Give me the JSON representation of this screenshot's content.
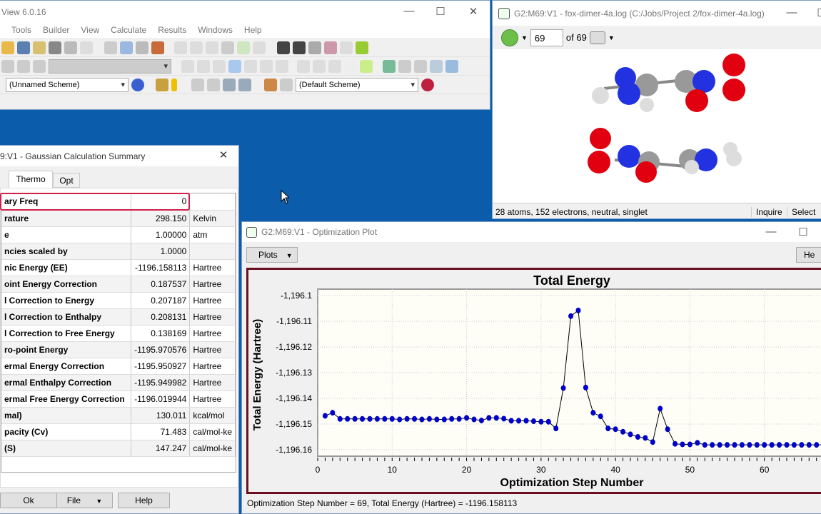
{
  "main_window": {
    "title": "View 6.0.16",
    "menu": [
      "Tools",
      "Builder",
      "View",
      "Calculate",
      "Results",
      "Windows",
      "Help"
    ],
    "scheme_left": "(Unnamed Scheme)",
    "scheme_right": "(Default Scheme)"
  },
  "molecule_window": {
    "title": "G2:M69:V1 - fox-dimer-4a.log (C:/Jobs/Project 2/fox-dimer-4a.log)",
    "frame": "69",
    "of_label": "of 69",
    "status": "28 atoms, 152 electrons, neutral, singlet",
    "inquire": "Inquire",
    "select": "Select"
  },
  "summary": {
    "title": "9:V1 - Gaussian Calculation Summary",
    "tabs": [
      "Thermo",
      "Opt"
    ],
    "active_tab": "Thermo",
    "rows": [
      {
        "label": "ary Freq",
        "value": "0",
        "unit": ""
      },
      {
        "label": "rature",
        "value": "298.150",
        "unit": "Kelvin"
      },
      {
        "label": "e",
        "value": "1.00000",
        "unit": "atm"
      },
      {
        "label": "ncies scaled by",
        "value": "1.0000",
        "unit": ""
      },
      {
        "label": "nic Energy (EE)",
        "value": "-1196.158113",
        "unit": "Hartree"
      },
      {
        "label": "oint Energy Correction",
        "value": "0.187537",
        "unit": "Hartree"
      },
      {
        "label": "l Correction to Energy",
        "value": "0.207187",
        "unit": "Hartree"
      },
      {
        "label": "l Correction to Enthalpy",
        "value": "0.208131",
        "unit": "Hartree"
      },
      {
        "label": "l Correction to Free Energy",
        "value": "0.138169",
        "unit": "Hartree"
      },
      {
        "label": "ro-point Energy",
        "value": "-1195.970576",
        "unit": "Hartree"
      },
      {
        "label": "ermal Energy Correction",
        "value": "-1195.950927",
        "unit": "Hartree"
      },
      {
        "label": "ermal Enthalpy Correction",
        "value": "-1195.949982",
        "unit": "Hartree"
      },
      {
        "label": "ermal Free Energy Correction",
        "value": "-1196.019944",
        "unit": "Hartree"
      },
      {
        "label": "mal)",
        "value": "130.011",
        "unit": "kcal/mol"
      },
      {
        "label": "pacity (Cv)",
        "value": "71.483",
        "unit": "cal/mol-ke"
      },
      {
        "label": "(S)",
        "value": "147.247",
        "unit": "cal/mol-ke"
      }
    ],
    "buttons": {
      "ok": "Ok",
      "file": "File",
      "help": "Help"
    }
  },
  "plot_window": {
    "title": "G2:M69:V1 - Optimization Plot",
    "plots_button": "Plots",
    "help_button": "He",
    "status": "Optimization Step Number = 69, Total Energy (Hartree) = -1196.158113"
  },
  "chart_data": {
    "type": "line",
    "title": "Total Energy",
    "xlabel": "Optimization Step Number",
    "ylabel": "Total Energy (Hartree)",
    "xlim": [
      0,
      70
    ],
    "ylim": [
      -1196.1625,
      -1196.0975
    ],
    "xticks": [
      0,
      10,
      20,
      30,
      40,
      50,
      60
    ],
    "xtick_labels": [
      "0",
      "10",
      "20",
      "30",
      "40",
      "50",
      "60"
    ],
    "yticks": [
      -1196.1,
      -1196.11,
      -1196.12,
      -1196.13,
      -1196.14,
      -1196.15,
      -1196.16
    ],
    "ytick_labels": [
      "-1,196.1",
      "-1,196.11",
      "-1,196.12",
      "-1,196.13",
      "-1,196.14",
      "-1,196.15",
      "-1,196.16"
    ],
    "grid": true,
    "line_color": "#000000",
    "marker_color": "#0000cc",
    "highlight_color": "#cc0033",
    "highlight_step": 69,
    "x": [
      1,
      2,
      3,
      4,
      5,
      6,
      7,
      8,
      9,
      10,
      11,
      12,
      13,
      14,
      15,
      16,
      17,
      18,
      19,
      20,
      21,
      22,
      23,
      24,
      25,
      26,
      27,
      28,
      29,
      30,
      31,
      32,
      33,
      34,
      35,
      36,
      37,
      38,
      39,
      40,
      41,
      42,
      43,
      44,
      45,
      46,
      47,
      48,
      49,
      50,
      51,
      52,
      53,
      54,
      55,
      56,
      57,
      58,
      59,
      60,
      61,
      62,
      63,
      64,
      65,
      66,
      67,
      68,
      69
    ],
    "y": [
      -1196.1468,
      -1196.1456,
      -1196.148,
      -1196.148,
      -1196.148,
      -1196.148,
      -1196.148,
      -1196.148,
      -1196.148,
      -1196.148,
      -1196.1482,
      -1196.148,
      -1196.148,
      -1196.1482,
      -1196.148,
      -1196.1482,
      -1196.1482,
      -1196.148,
      -1196.148,
      -1196.1476,
      -1196.1482,
      -1196.1486,
      -1196.1476,
      -1196.1476,
      -1196.1479,
      -1196.1487,
      -1196.1487,
      -1196.1487,
      -1196.1489,
      -1196.1491,
      -1196.1491,
      -1196.1517,
      -1196.136,
      -1196.108,
      -1196.1058,
      -1196.1358,
      -1196.1456,
      -1196.147,
      -1196.1517,
      -1196.152,
      -1196.153,
      -1196.154,
      -1196.155,
      -1196.1554,
      -1196.157,
      -1196.144,
      -1196.152,
      -1196.1577,
      -1196.1579,
      -1196.1579,
      -1196.1573,
      -1196.1581,
      -1196.1581,
      -1196.1581,
      -1196.1581,
      -1196.1581,
      -1196.1581,
      -1196.1581,
      -1196.1581,
      -1196.1581,
      -1196.1581,
      -1196.1581,
      -1196.1581,
      -1196.1581,
      -1196.1581,
      -1196.1581,
      -1196.1581,
      -1196.1581,
      -1196.1581
    ]
  }
}
